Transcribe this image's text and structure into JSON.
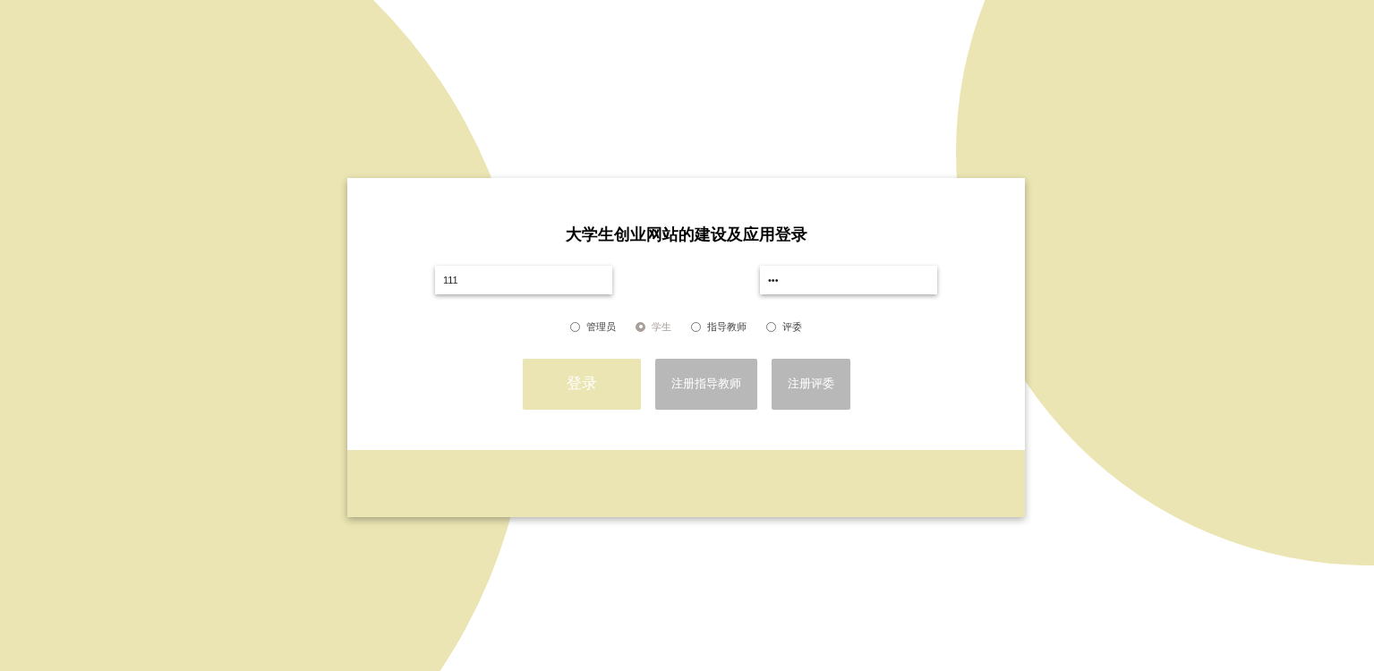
{
  "title": "大学生创业网站的建设及应用登录",
  "fields": [
    {
      "value": "111"
    },
    {
      "value": "•••"
    }
  ],
  "roles": [
    {
      "label": "管理员",
      "selected": false
    },
    {
      "label": "学生",
      "selected": true
    },
    {
      "label": "指导教师",
      "selected": false
    },
    {
      "label": "评委",
      "selected": false
    }
  ],
  "buttons": [
    {
      "kind": "primary",
      "label": "登录"
    },
    {
      "kind": "secondary",
      "label": "注册指导教师"
    },
    {
      "kind": "secondary",
      "label": "注册评委"
    }
  ]
}
